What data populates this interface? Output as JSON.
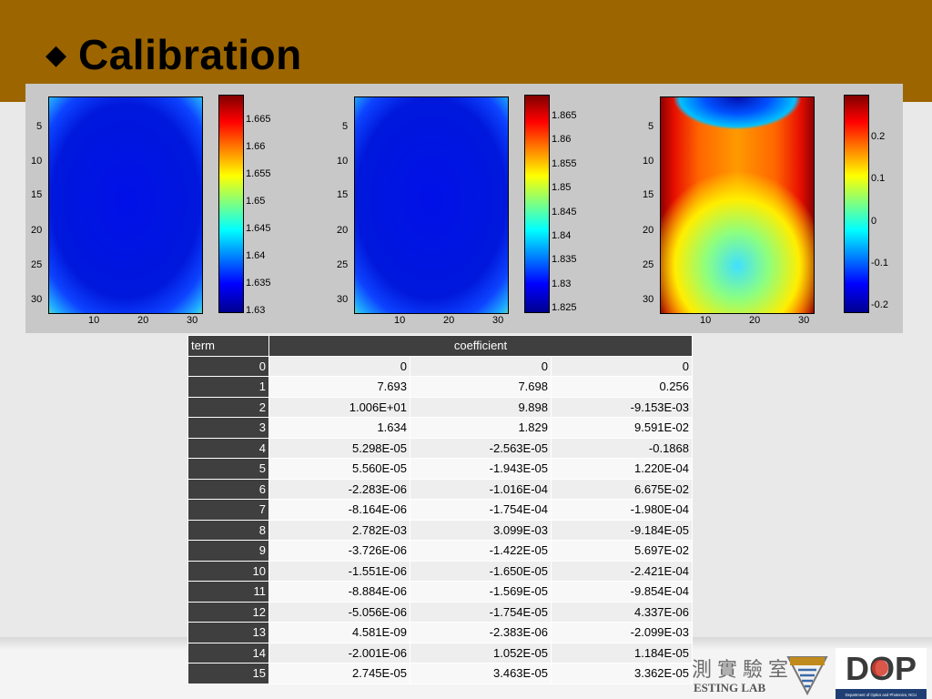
{
  "slide": {
    "bullet": "◆",
    "title": "Calibration",
    "bullet_icon": "diamond-bullet-icon",
    "colors": {
      "title_bar": "#9c6500",
      "table_header": "#3f3f3f"
    }
  },
  "figures": {
    "y_ticks": [
      "5",
      "10",
      "15",
      "20",
      "25",
      "30"
    ],
    "x_ticks": [
      "10",
      "20",
      "30"
    ],
    "colormap": "jet",
    "plot1": {
      "colorbar_ticks": [
        "1.665",
        "1.66",
        "1.655",
        "1.65",
        "1.645",
        "1.64",
        "1.635",
        "1.63"
      ]
    },
    "plot2": {
      "colorbar_ticks": [
        "1.865",
        "1.86",
        "1.855",
        "1.85",
        "1.845",
        "1.84",
        "1.835",
        "1.83",
        "1.825"
      ]
    },
    "plot3": {
      "colorbar_ticks": [
        "0.2",
        "0.1",
        "0",
        "-0.1",
        "-0.2"
      ]
    }
  },
  "table": {
    "header_term": "term",
    "header_coefficient": "coefficient",
    "rows": [
      {
        "term": "0",
        "c1": "0",
        "c2": "0",
        "c3": "0"
      },
      {
        "term": "1",
        "c1": "7.693",
        "c2": "7.698",
        "c3": "0.256"
      },
      {
        "term": "2",
        "c1": "1.006E+01",
        "c2": "9.898",
        "c3": "-9.153E-03"
      },
      {
        "term": "3",
        "c1": "1.634",
        "c2": "1.829",
        "c3": "9.591E-02"
      },
      {
        "term": "4",
        "c1": "5.298E-05",
        "c2": "-2.563E-05",
        "c3": "-0.1868"
      },
      {
        "term": "5",
        "c1": "5.560E-05",
        "c2": "-1.943E-05",
        "c3": "1.220E-04"
      },
      {
        "term": "6",
        "c1": "-2.283E-06",
        "c2": "-1.016E-04",
        "c3": "6.675E-02"
      },
      {
        "term": "7",
        "c1": "-8.164E-06",
        "c2": "-1.754E-04",
        "c3": "-1.980E-04"
      },
      {
        "term": "8",
        "c1": "2.782E-03",
        "c2": "3.099E-03",
        "c3": "-9.184E-05"
      },
      {
        "term": "9",
        "c1": "-3.726E-06",
        "c2": "-1.422E-05",
        "c3": "5.697E-02"
      },
      {
        "term": "10",
        "c1": "-1.551E-06",
        "c2": "-1.650E-05",
        "c3": "-2.421E-04"
      },
      {
        "term": "11",
        "c1": "-8.884E-06",
        "c2": "-1.569E-05",
        "c3": "-9.854E-04"
      },
      {
        "term": "12",
        "c1": "-5.056E-06",
        "c2": "-1.754E-05",
        "c3": "4.337E-06"
      },
      {
        "term": "13",
        "c1": "4.581E-09",
        "c2": "-2.383E-06",
        "c3": "-2.099E-03"
      },
      {
        "term": "14",
        "c1": "-2.001E-06",
        "c2": "1.052E-05",
        "c3": "1.184E-05"
      },
      {
        "term": "15",
        "c1": "2.745E-05",
        "c2": "3.463E-05",
        "c3": "3.362E-05"
      }
    ]
  },
  "footer": {
    "lab_cn": "測實驗室",
    "lab_en": "ESTING LAB",
    "dop_logo_text": "DOP",
    "dop_caption": "Department of Optics and Photonics, NCU",
    "emblem_icon": "ncu-emblem-icon",
    "dop_icon": "dop-logo-icon"
  }
}
